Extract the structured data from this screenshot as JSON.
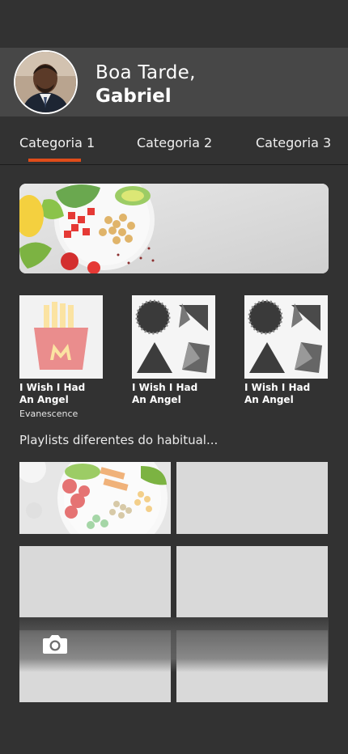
{
  "header": {
    "greeting": "Boa Tarde,",
    "name": "Gabriel"
  },
  "tabs": [
    {
      "label": "Categoria 1",
      "active": true
    },
    {
      "label": "Categoria 2",
      "active": false
    },
    {
      "label": "Categoria 3",
      "active": false
    }
  ],
  "albums": [
    {
      "title_line1": "I Wish I Had",
      "title_line2": "An Angel",
      "artist": "Evanescence",
      "art": "fries-icon"
    },
    {
      "title_line1": "I Wish I Had",
      "title_line2": "An Angel",
      "artist": "",
      "art": "abstract-shapes"
    },
    {
      "title_line1": "I Wish I Had",
      "title_line2": "An Angel",
      "artist": "",
      "art": "abstract-shapes"
    }
  ],
  "playlists": {
    "title": "Playlists diferentes do habitual..."
  },
  "colors": {
    "background": "#323232",
    "header": "#474747",
    "accent": "#e04c1a",
    "placeholder": "#d9d9d9"
  }
}
